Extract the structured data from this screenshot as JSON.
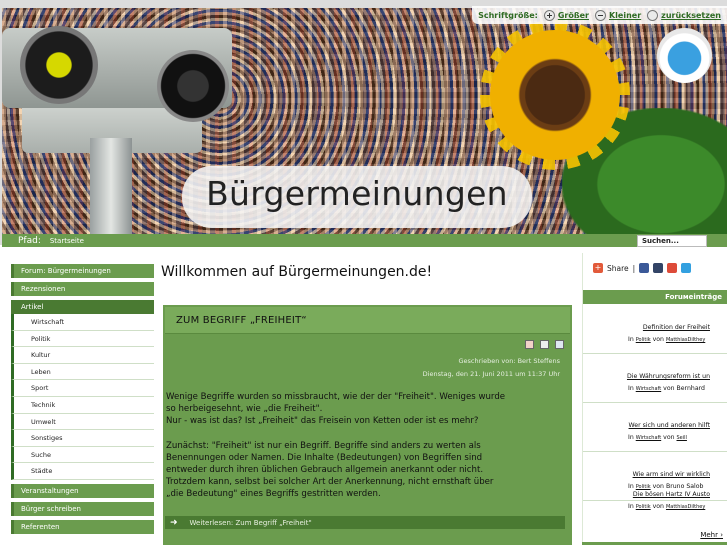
{
  "header": {
    "site_title": "Bürgermeinungen",
    "fontbar": {
      "label": "Schriftgröße:",
      "bigger": "Größer",
      "smaller": "Kleiner",
      "reset": "zurücksetzen"
    }
  },
  "pathbar": {
    "label": "Pfad:",
    "home": "Startseite",
    "search_placeholder": "Suchen..."
  },
  "leftnav": {
    "top_items": [
      "Forum: Bürgermeinungen",
      "Rezensionen"
    ],
    "active_item": "Artikel",
    "sub_items": [
      "Wirtschaft",
      "Politik",
      "Kultur",
      "Leben",
      "Sport",
      "Technik",
      "Umwelt",
      "Sonstiges",
      "Suche",
      "Städte"
    ],
    "bottom_items": [
      "Veranstaltungen",
      "Bürger schreiben",
      "Referenten"
    ]
  },
  "main": {
    "welcome": "Willkommen auf Bürgermeinungen.de!",
    "article": {
      "title": "ZUM BEGRIFF „FREIHEIT“",
      "author": "Geschrieben von: Bert Steffens",
      "date": "Dienstag, den 21. Juni 2011 um 11:37 Uhr",
      "para1_l1": "Wenige Begriffe wurden so missbraucht, wie der der \"Freiheit\". Weniges wurde",
      "para1_l2": "so herbeigesehnt, wie „die Freiheit\".",
      "para1_l3": "Nur - was ist das? Ist „Freiheit\" das Freisein von Ketten oder ist es mehr?",
      "para2_l1": "Zunächst: \"Freiheit\" ist nur ein Begriff. Begriffe sind anders zu werten als",
      "para2_l2": "Benennungen oder Namen. Die Inhalte (Bedeutungen) von Begriffen sind",
      "para2_l3": "entweder durch ihren üblichen Gebrauch allgemein anerkannt oder nicht.",
      "para2_l4": "Trotzdem kann, selbst bei solcher Art der Anerkennung, nicht ernsthaft über",
      "para2_l5": "„die Bedeutung\" eines Begriffs gestritten werden.",
      "readmore": "Weiterlesen: Zum Begriff „Freiheit\""
    }
  },
  "right": {
    "share": "Share",
    "separator": "|",
    "forum_heading": "Foruмeinträge",
    "entries": [
      {
        "title": "Definition der Freiheit",
        "in": "In",
        "cat": "Politik",
        "von": "von",
        "user": "MatthiasDilthey"
      },
      {
        "title": "Die Währungsreform ist un",
        "in": "In",
        "cat": "Wirtschaft",
        "von": "von",
        "user": "Bernhard"
      },
      {
        "title": "Wer sich und anderen hilft",
        "in": "In",
        "cat": "Wirtschaft",
        "von": "von",
        "user": "Seill"
      },
      {
        "title": "Wie arm sind wir wirklich",
        "in": "In",
        "cat": "Politik",
        "von": "von",
        "user": "Bruno Salob"
      },
      {
        "title": "Die bösen Hartz IV Austo",
        "in": "In",
        "cat": "Politik",
        "von": "von",
        "user": "MatthiasDilthey"
      }
    ],
    "more": "Mehr ›"
  },
  "colors": {
    "green": "#6b9c4e",
    "dark_green": "#4a7a32",
    "link_green": "#2f6b23"
  },
  "icons": [
    "plus-circle-icon",
    "minus-circle-icon",
    "reset-circle-icon",
    "pdf-icon",
    "print-icon",
    "email-icon",
    "share-plus-icon",
    "facebook-icon",
    "myspace-icon",
    "google-icon",
    "twitter-icon",
    "arrow-right-icon"
  ]
}
